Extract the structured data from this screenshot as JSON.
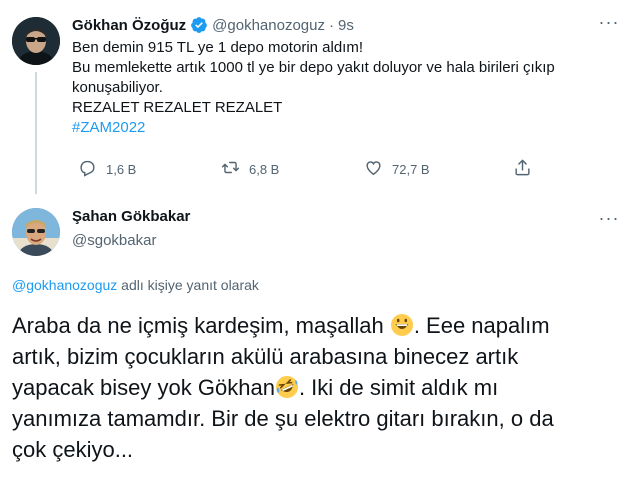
{
  "tweet": {
    "author_name": "Gökhan Özoğuz",
    "author_handle": "@gokhanozoguz",
    "separator": "·",
    "time": "9s",
    "lines": [
      "Ben demin  915 TL ye 1 depo motorin aldım!",
      "Bu memlekette artık 1000 tl ye bir depo yakıt doluyor ve hala birileri çıkıp",
      "konuşabiliyor.",
      "REZALET REZALET REZALET"
    ],
    "hashtag": "#ZAM2022",
    "more_label": "···",
    "actions": {
      "reply_count": "1,6 B",
      "retweet_count": "6,8 B",
      "like_count": "72,7 B"
    }
  },
  "reply": {
    "author_name": "Şahan Gökbakar",
    "author_handle": "@sgokbakar",
    "more_label": "···",
    "replying_to": {
      "mention": "@gokhanozoguz",
      "suffix": " adlı kişiye yanıt olarak"
    },
    "text": {
      "line1_a": "Araba da ne içmiş kardeşim, maşallah ",
      "line1_b": ". Eee napalım",
      "line2": "artık, bizim çocukların  akülü arabasına binecez artık",
      "line3_a": "yapacak bisey yok Gökhan",
      "line3_b": ". Iki de simit aldık mı",
      "line4": "yanımıza tamamdır. Bir de şu elektro gitarı bırakın, o da",
      "line5": "çok çekiyo..."
    }
  },
  "icons": {
    "verified": "verified-badge-icon",
    "reply": "reply-icon",
    "retweet": "retweet-icon",
    "like": "heart-icon",
    "share": "share-icon",
    "emoji1": "grinning-face-emoji",
    "emoji2": "rolling-laughing-emoji"
  },
  "colors": {
    "accent": "#1d9bf0",
    "text": "#0f1419",
    "secondary": "#536471",
    "thread_line": "#cfd9de"
  }
}
